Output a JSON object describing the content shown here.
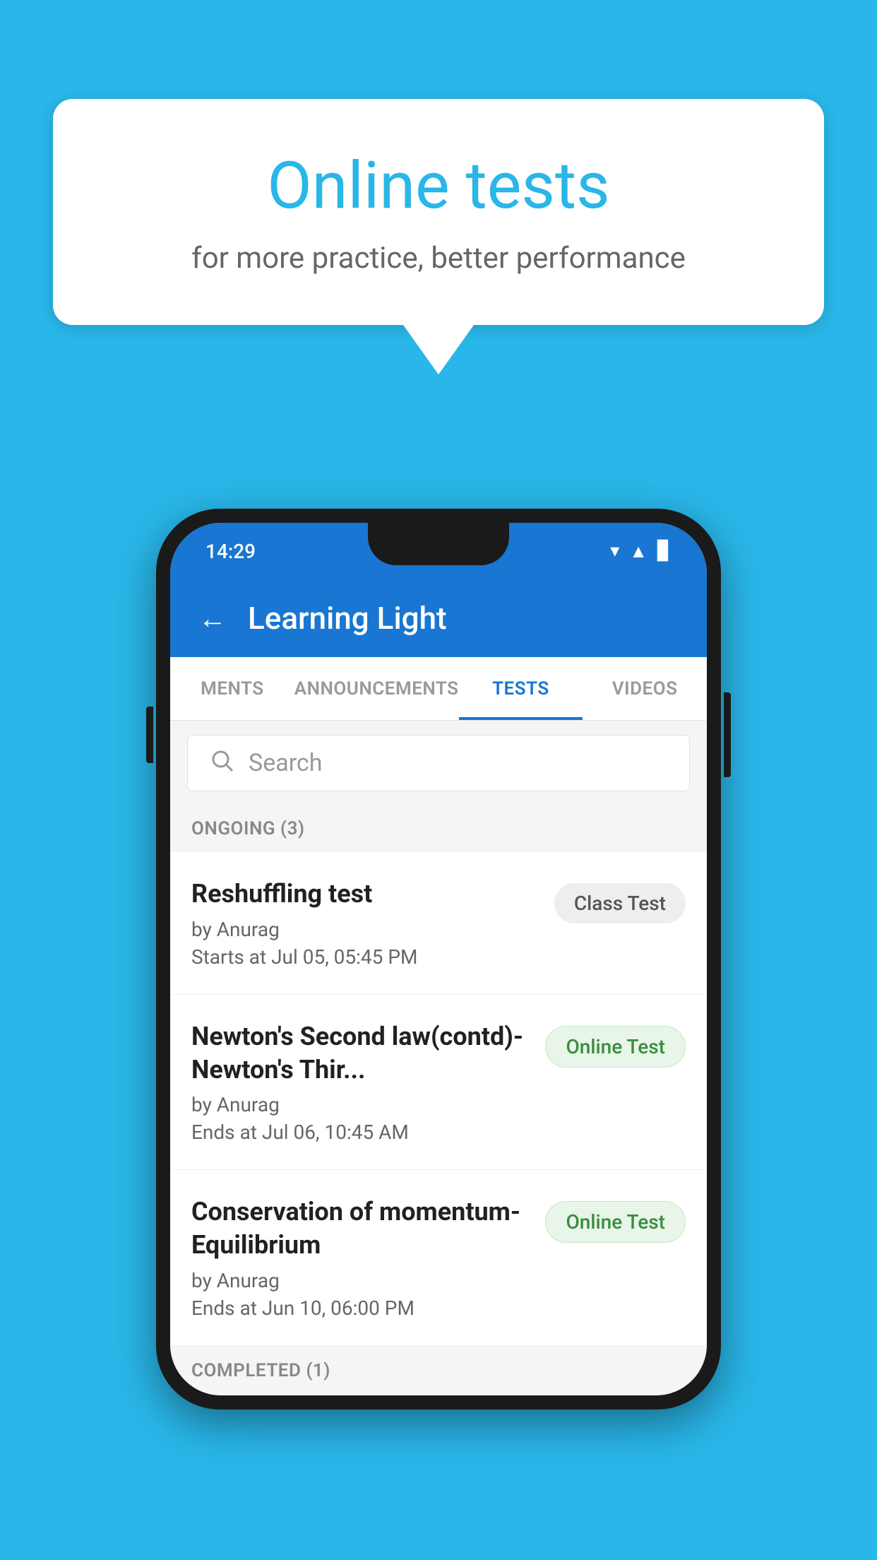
{
  "background": {
    "color": "#29b6e8"
  },
  "speech_bubble": {
    "title": "Online tests",
    "subtitle": "for more practice, better performance"
  },
  "phone": {
    "status_bar": {
      "time": "14:29"
    },
    "app_bar": {
      "title": "Learning Light",
      "back_icon": "←"
    },
    "tabs": [
      {
        "label": "MENTS",
        "active": false
      },
      {
        "label": "ANNOUNCEMENTS",
        "active": false
      },
      {
        "label": "TESTS",
        "active": true
      },
      {
        "label": "VIDEOS",
        "active": false
      }
    ],
    "search": {
      "placeholder": "Search"
    },
    "ongoing_section": {
      "label": "ONGOING (3)"
    },
    "test_items": [
      {
        "title": "Reshuffling test",
        "author": "by Anurag",
        "date": "Starts at  Jul 05, 05:45 PM",
        "badge": "Class Test",
        "badge_type": "class"
      },
      {
        "title": "Newton's Second law(contd)-Newton's Thir...",
        "author": "by Anurag",
        "date": "Ends at  Jul 06, 10:45 AM",
        "badge": "Online Test",
        "badge_type": "online"
      },
      {
        "title": "Conservation of momentum-Equilibrium",
        "author": "by Anurag",
        "date": "Ends at  Jun 10, 06:00 PM",
        "badge": "Online Test",
        "badge_type": "online"
      }
    ],
    "completed_section": {
      "label": "COMPLETED (1)"
    }
  }
}
